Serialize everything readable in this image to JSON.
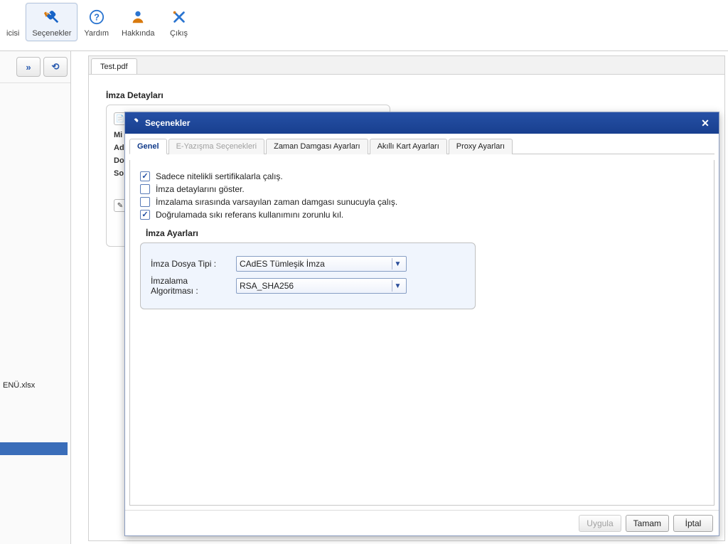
{
  "toolbar": {
    "items": [
      {
        "label": "icisi",
        "icon": "wrench"
      },
      {
        "label": "Seçenekler",
        "icon": "wrench-cross",
        "selected": true
      },
      {
        "label": "Yardım",
        "icon": "question"
      },
      {
        "label": "Hakkında",
        "icon": "person"
      },
      {
        "label": "Çıkış",
        "icon": "cross"
      }
    ]
  },
  "left": {
    "file_label": "ENÜ.xlsx"
  },
  "main": {
    "tab": "Test.pdf",
    "section_title": "İmza Detayları",
    "fields": {
      "mi": "Mi",
      "ad": "Ad",
      "do": "Do",
      "so": "So"
    }
  },
  "dialog": {
    "title": "Seçenekler",
    "tabs": [
      "Genel",
      "E-Yazışma Seçenekleri",
      "Zaman Damgası Ayarları",
      "Akıllı Kart Ayarları",
      "Proxy Ayarları"
    ],
    "active_tab": 0,
    "checks": [
      {
        "label": "Sadece nitelikli sertifikalarla çalış.",
        "checked": true
      },
      {
        "label": "İmza detaylarını göster.",
        "checked": false
      },
      {
        "label": "İmzalama sırasında varsayılan zaman damgası sunucuyla çalış.",
        "checked": false
      },
      {
        "label": "Doğrulamada sıkı referans kullanımını zorunlu kıl.",
        "checked": true
      }
    ],
    "sig_group": "İmza Ayarları",
    "sig_type_label": "İmza Dosya Tipi :",
    "sig_type_value": "CAdES Tümleşik İmza",
    "sig_alg_label": "İmzalama Algoritması :",
    "sig_alg_value": "RSA_SHA256",
    "btn_apply": "Uygula",
    "btn_ok": "Tamam",
    "btn_cancel": "İptal"
  }
}
